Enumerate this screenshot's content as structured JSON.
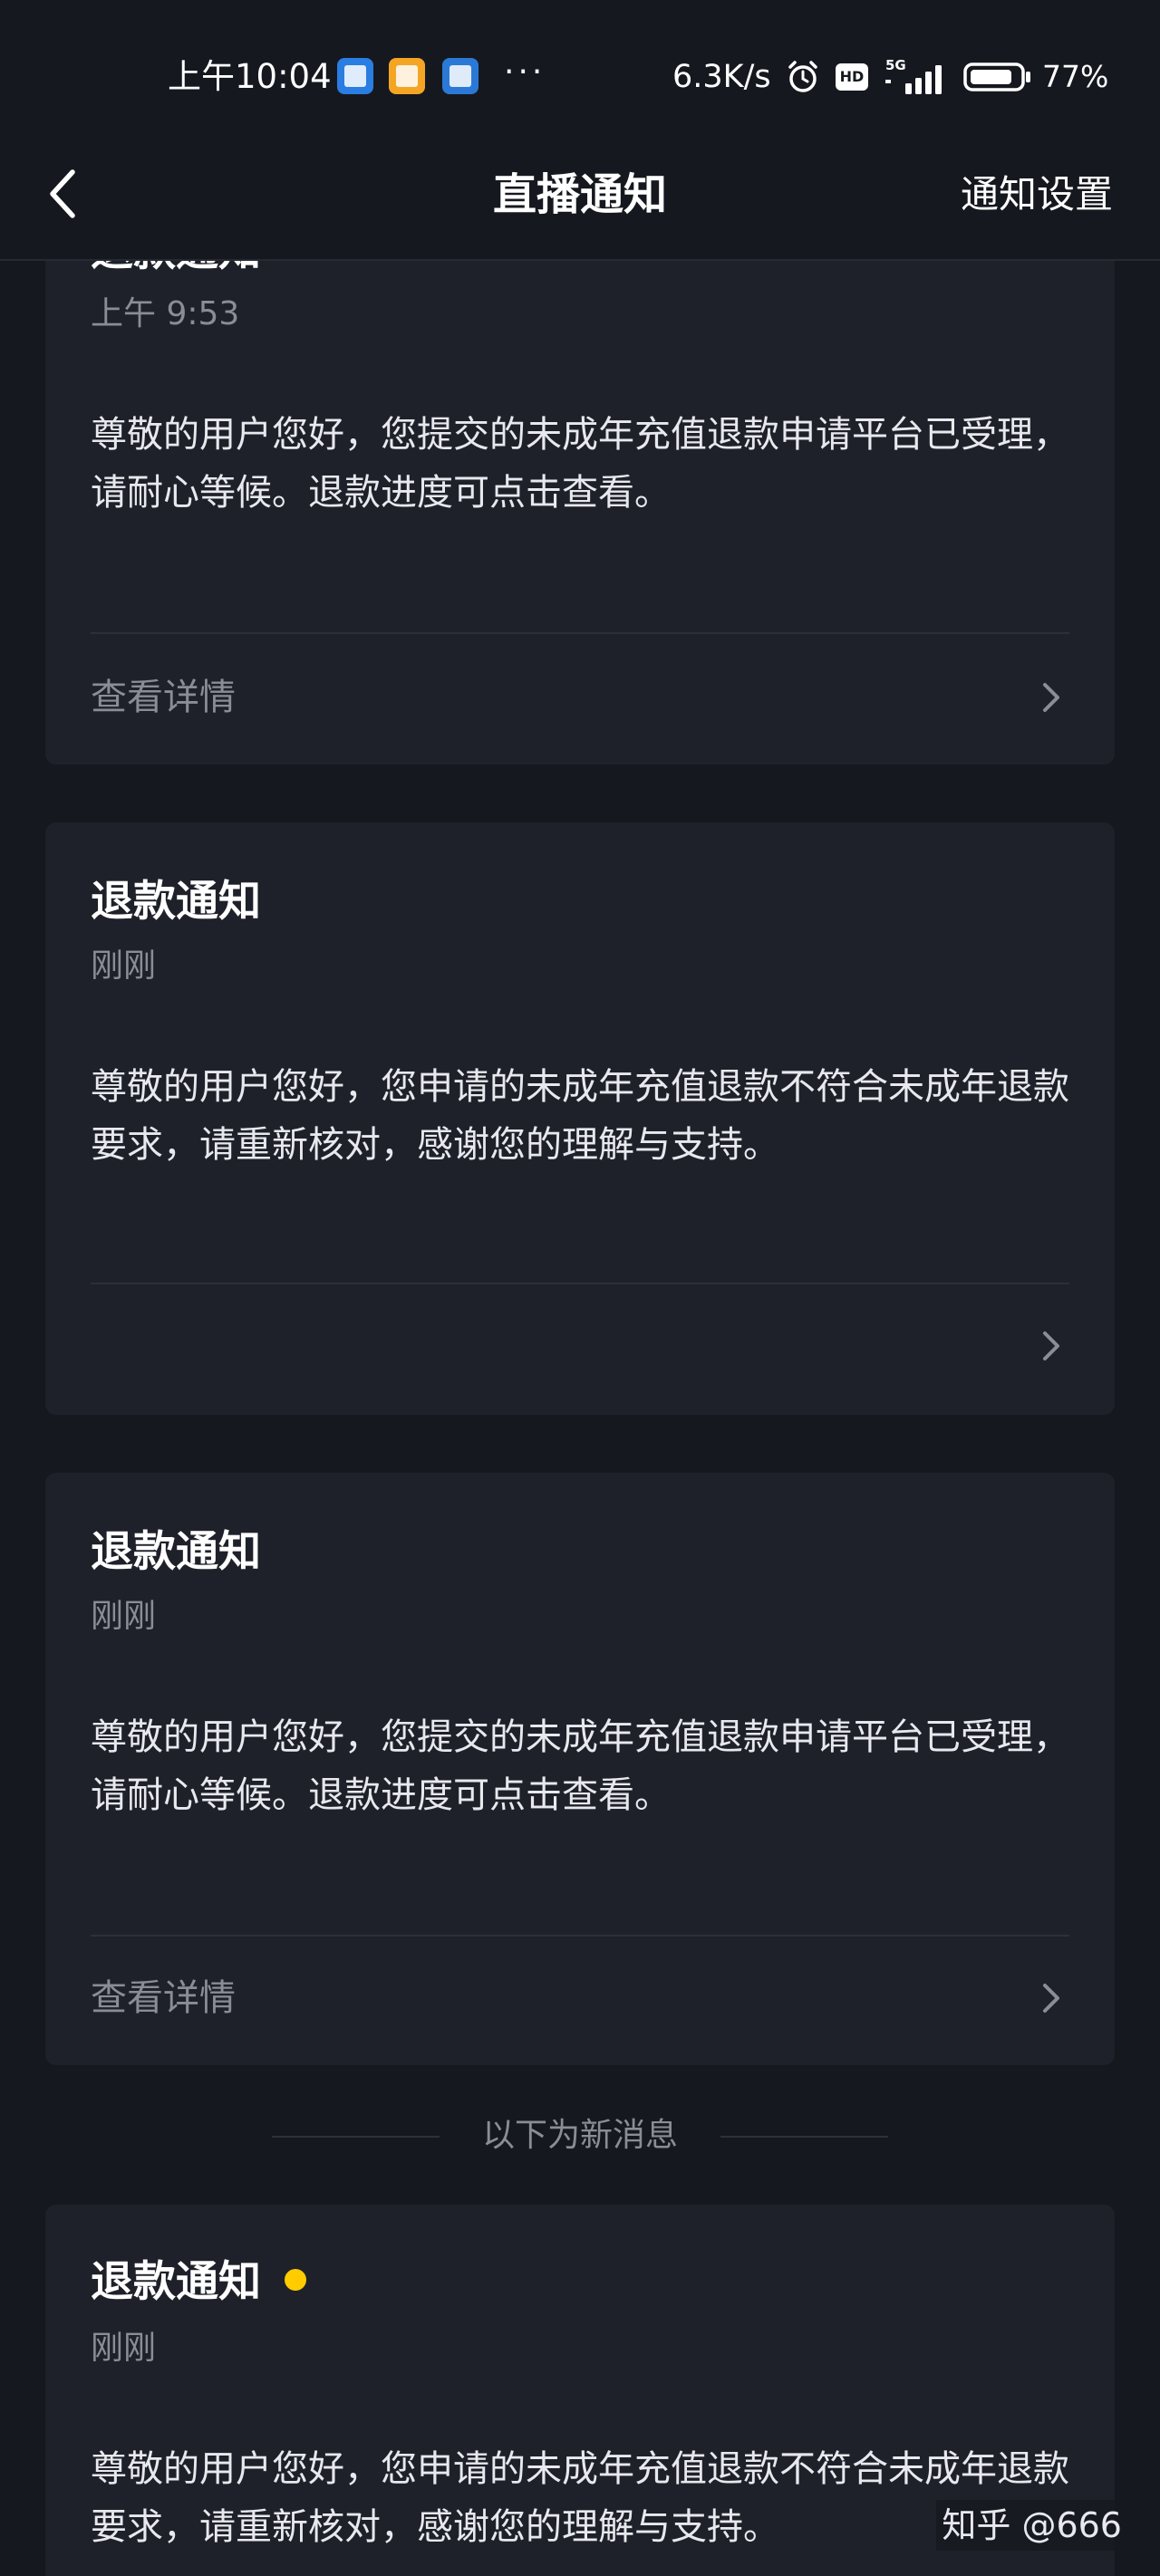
{
  "status_bar": {
    "time": "上午10:04",
    "more": "···",
    "net_speed": "6.3K/s",
    "hd_badge": "HD",
    "network_type": "5G",
    "battery_percent": "77%",
    "notification_icons": [
      "app-icon-blue",
      "app-icon-orange",
      "app-icon-blue-2"
    ]
  },
  "nav": {
    "title": "直播通知",
    "settings_label": "通知设置",
    "back_icon": "chevron-left-icon"
  },
  "cards": [
    {
      "title": "退款通知",
      "time": "上午 9:53",
      "body": "尊敬的用户您好，您提交的未成年充值退款申请平台已受理，请耐心等候。退款进度可点击查看。",
      "link": "查看详情",
      "unread": false
    },
    {
      "title": "退款通知",
      "time": "刚刚",
      "body": "尊敬的用户您好，您申请的未成年充值退款不符合未成年退款要求，请重新核对，感谢您的理解与支持。",
      "link": "",
      "unread": false
    },
    {
      "title": "退款通知",
      "time": "刚刚",
      "body": "尊敬的用户您好，您提交的未成年充值退款申请平台已受理，请耐心等候。退款进度可点击查看。",
      "link": "查看详情",
      "unread": false
    },
    {
      "title": "退款通知",
      "time": "刚刚",
      "body": "尊敬的用户您好，您申请的未成年充值退款不符合未成年退款要求，请重新核对，感谢您的理解与支持。",
      "link": "",
      "unread": true
    }
  ],
  "separator": {
    "label": "以下为新消息"
  },
  "watermark": "知乎 @666",
  "colors": {
    "background": "#16181f",
    "card": "#1f212a",
    "unread_dot": "#ffcc00",
    "muted_text": "#8b8d96"
  }
}
